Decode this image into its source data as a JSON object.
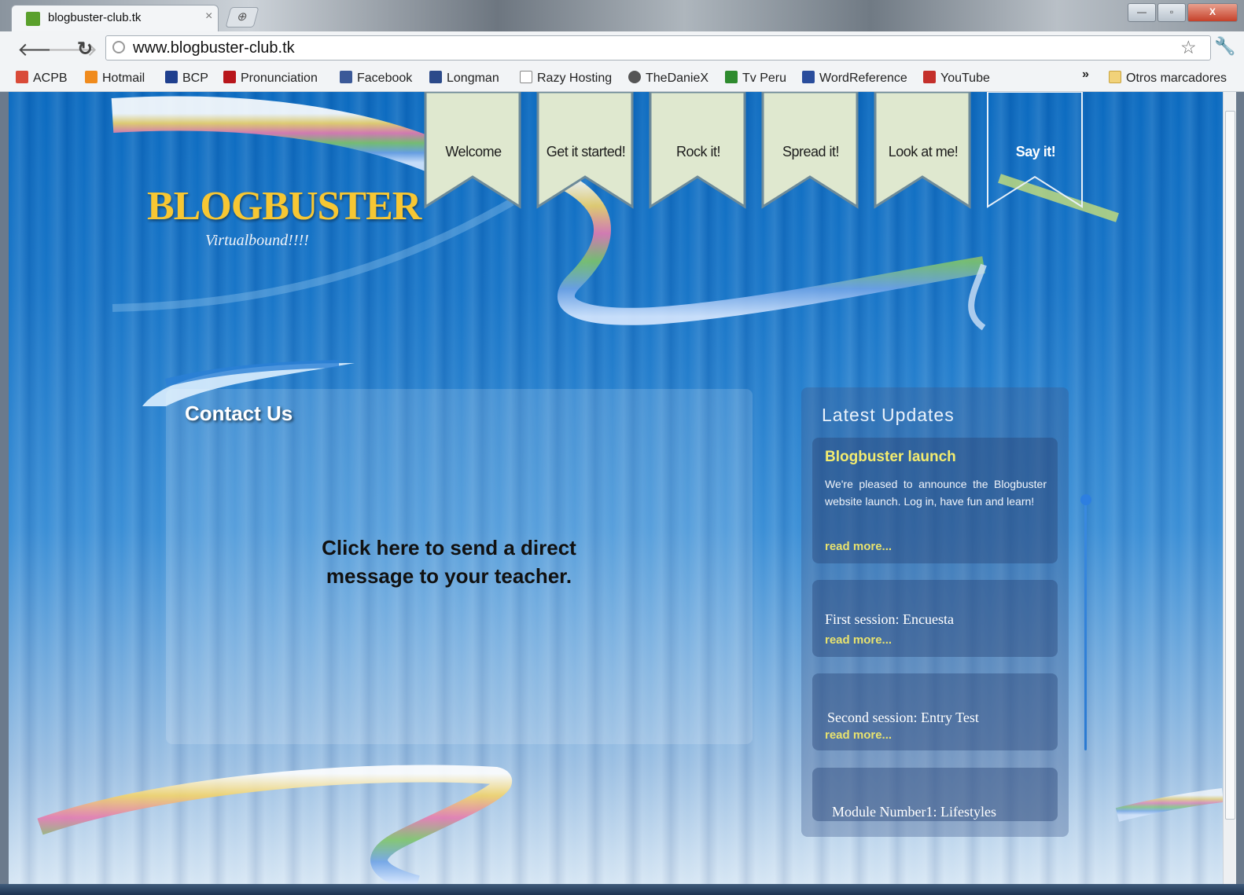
{
  "browser": {
    "tab_title": "blogbuster-club.tk",
    "tab_close": "×",
    "new_tab": "⊕",
    "url": "www.blogbuster-club.tk",
    "window_buttons": [
      "—",
      "▫",
      "X"
    ]
  },
  "bookmarks": [
    {
      "label": "ACPB",
      "color": "#d94a38"
    },
    {
      "label": "Hotmail",
      "color": "#f08b1d"
    },
    {
      "label": "BCP",
      "color": "#1f3f8e"
    },
    {
      "label": "Pronunciation",
      "color": "#b8161b"
    },
    {
      "label": "Facebook",
      "color": "#3b5998"
    },
    {
      "label": "Longman",
      "color": "#2b4a8a"
    },
    {
      "label": "Razy Hosting",
      "color": "#ffffff"
    },
    {
      "label": "TheDanieX",
      "color": "#555555"
    },
    {
      "label": "Tv Peru",
      "color": "#2e8b2e"
    },
    {
      "label": "WordReference",
      "color": "#2a4d9c"
    },
    {
      "label": "YouTube",
      "color": "#c4302b"
    }
  ],
  "bookmarks_more": "»",
  "other_bookmarks": "Otros marcadores",
  "site": {
    "logo": "BLOGBUSTER",
    "tagline": "Virtualbound!!!!",
    "nav": [
      "Welcome",
      "Get it started!",
      "Rock it!",
      "Spread it!",
      "Look at me!",
      "Say it!"
    ],
    "active_nav": "Say it!",
    "contact": {
      "title": "Contact Us",
      "message": "Click here to send a direct message to your teacher."
    },
    "updates": {
      "title": "Latest Updates",
      "items": [
        {
          "title": "Blogbuster launch",
          "text": "We're pleased to announce the Blogbuster website launch. Log in, have fun and learn!",
          "link": "read more..."
        },
        {
          "title": "First session: Encuesta",
          "link": "read more..."
        },
        {
          "title": "Second session: Entry Test",
          "link": "read more..."
        },
        {
          "title": "Module Number1: Lifestyles"
        }
      ]
    }
  },
  "colors": {
    "page_blue": "#1976c8",
    "logo_gold": "#f7c733",
    "nav_flag": "#dfe8cf",
    "update_link": "#e9e36e"
  }
}
